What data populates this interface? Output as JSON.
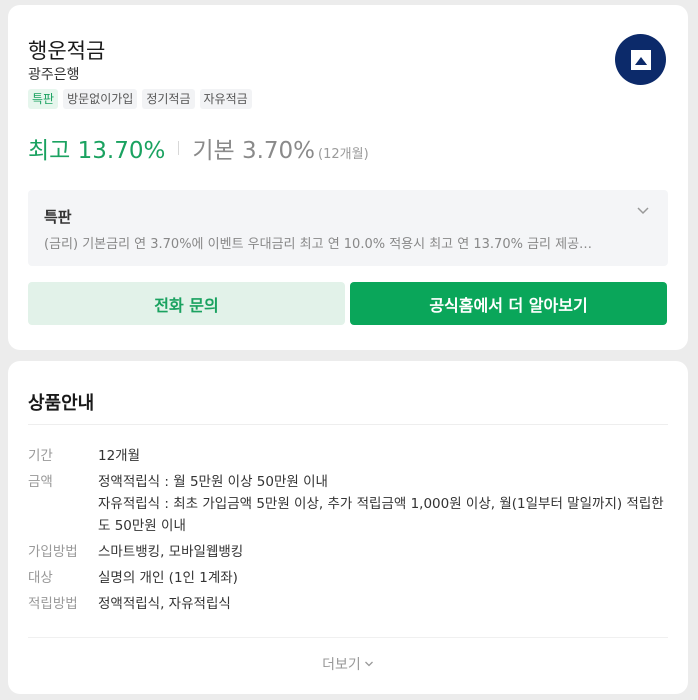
{
  "product": {
    "title": "행운적금",
    "bank": "광주은행",
    "tags": [
      "특판",
      "방문없이가입",
      "정기적금",
      "자유적금"
    ],
    "rate_max": "최고 13.70%",
    "rate_base": "기본 3.70%",
    "term": "(12개월)",
    "special": {
      "label": "특판",
      "description": "(금리) 기본금리 연 3.70%에 이벤트 우대금리 최고 연 10.0% 적용시 최고 연 13.70% 금리 제공…"
    },
    "buttons": {
      "phone": "전화 문의",
      "homepage": "공식홈에서 더 알아보기"
    },
    "logo_icon": "bank-logo-icon",
    "brand_color": "#0c2a6a",
    "accent_color": "#1aa260"
  },
  "info": {
    "title": "상품안내",
    "rows": [
      {
        "key": "기간",
        "value": [
          "12개월"
        ]
      },
      {
        "key": "금액",
        "value": [
          "정액적립식 : 월 5만원 이상 50만원 이내",
          "자유적립식 : 최초 가입금액 5만원 이상, 추가 적립금액 1,000원 이상, 월(1일부터 말일까지) 적립한도 50만원 이내"
        ]
      },
      {
        "key": "가입방법",
        "value": [
          "스마트뱅킹, 모바일웹뱅킹"
        ]
      },
      {
        "key": "대상",
        "value": [
          "실명의 개인 (1인 1계좌)"
        ]
      },
      {
        "key": "적립방법",
        "value": [
          "정액적립식, 자유적립식"
        ]
      }
    ],
    "more": "더보기"
  }
}
